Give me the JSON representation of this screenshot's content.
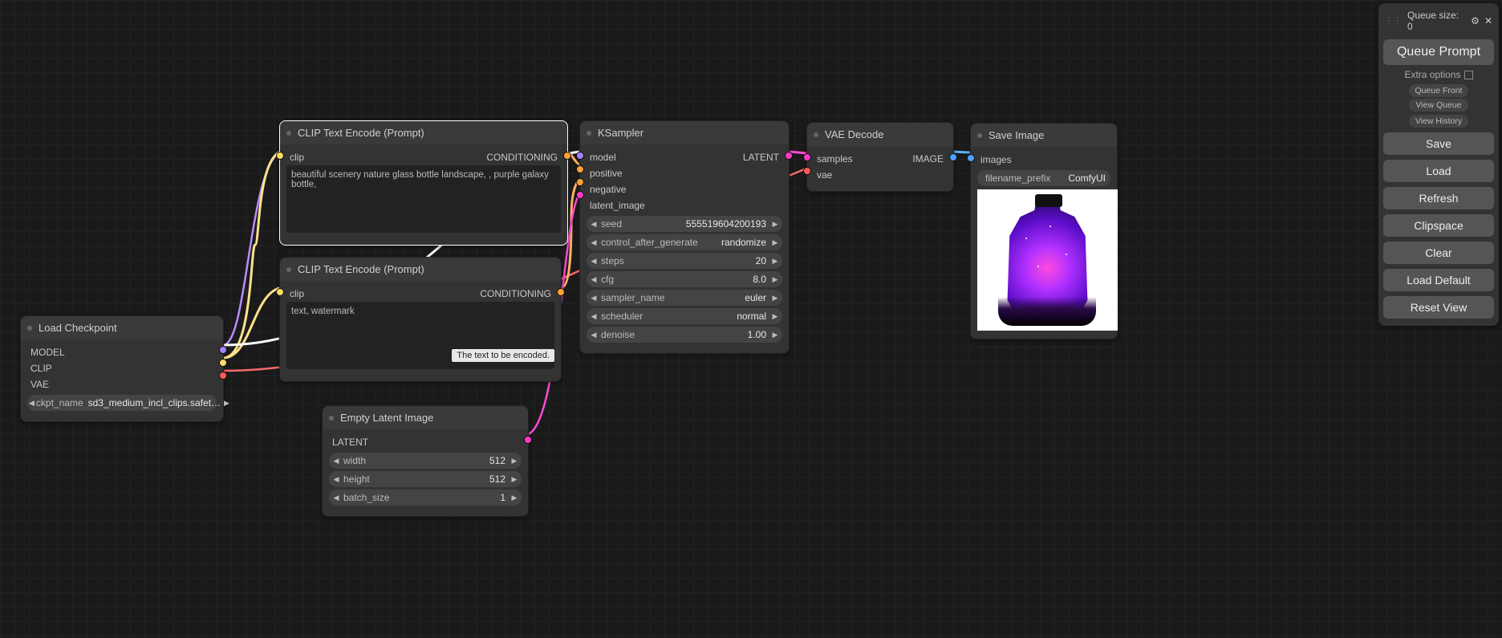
{
  "sidebar": {
    "queue_label": "Queue size: 0",
    "queue_prompt": "Queue Prompt",
    "extra_options": "Extra options",
    "queue_front": "Queue Front",
    "view_queue": "View Queue",
    "view_history": "View History",
    "save": "Save",
    "load": "Load",
    "refresh": "Refresh",
    "clipspace": "Clipspace",
    "clear": "Clear",
    "load_default": "Load Default",
    "reset_view": "Reset View"
  },
  "nodes": {
    "load_ckpt": {
      "title": "Load Checkpoint",
      "out_model": "MODEL",
      "out_clip": "CLIP",
      "out_vae": "VAE",
      "p_name": "ckpt_name",
      "p_val": "sd3_medium_incl_clips.safet…"
    },
    "clip_pos": {
      "title": "CLIP Text Encode (Prompt)",
      "in_clip": "clip",
      "out_cond": "CONDITIONING",
      "text": "beautiful scenery nature glass bottle landscape, , purple galaxy bottle,"
    },
    "clip_neg": {
      "title": "CLIP Text Encode (Prompt)",
      "in_clip": "clip",
      "out_cond": "CONDITIONING",
      "text": "text, watermark",
      "tooltip": "The text to be encoded."
    },
    "empty_latent": {
      "title": "Empty Latent Image",
      "out": "LATENT",
      "p": [
        [
          "width",
          "512"
        ],
        [
          "height",
          "512"
        ],
        [
          "batch_size",
          "1"
        ]
      ]
    },
    "ksampler": {
      "title": "KSampler",
      "in": [
        "model",
        "positive",
        "negative",
        "latent_image"
      ],
      "out": "LATENT",
      "p": [
        [
          "seed",
          "555519604200193"
        ],
        [
          "control_after_generate",
          "randomize"
        ],
        [
          "steps",
          "20"
        ],
        [
          "cfg",
          "8.0"
        ],
        [
          "sampler_name",
          "euler"
        ],
        [
          "scheduler",
          "normal"
        ],
        [
          "denoise",
          "1.00"
        ]
      ]
    },
    "vae_decode": {
      "title": "VAE Decode",
      "in": [
        "samples",
        "vae"
      ],
      "out": "IMAGE"
    },
    "save_image": {
      "title": "Save Image",
      "in": "images",
      "p_name": "filename_prefix",
      "p_val": "ComfyUI"
    }
  }
}
